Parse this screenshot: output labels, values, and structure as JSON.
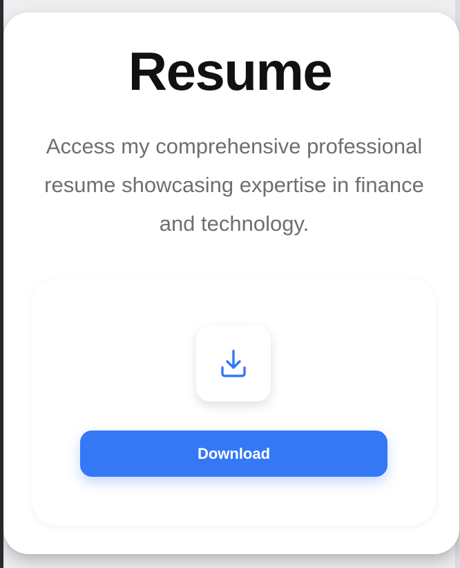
{
  "page": {
    "title": "Resume",
    "description": "Access my comprehensive professional resume showcasing expertise in finance and technology."
  },
  "download": {
    "icon": "download-icon",
    "button_label": "Download"
  },
  "colors": {
    "accent": "#3478f6",
    "title_text": "#111111",
    "body_text": "#6e6e73",
    "background": "#eeeef0"
  }
}
